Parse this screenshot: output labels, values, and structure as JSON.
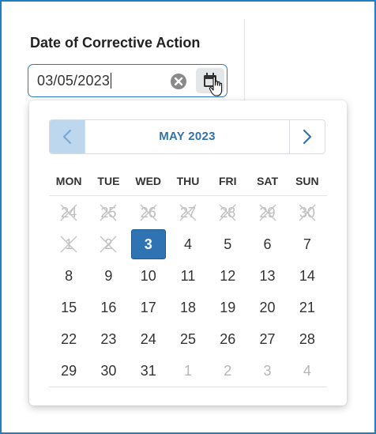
{
  "field": {
    "label": "Date of Corrective Action",
    "value": "03/05/2023"
  },
  "icons": {
    "clear": "clear-x-circle-icon",
    "calendar": "calendar-icon"
  },
  "calendar": {
    "month_title": "MAY 2023",
    "weekdays": [
      "MON",
      "TUE",
      "WED",
      "THU",
      "FRI",
      "SAT",
      "SUN"
    ],
    "weeks": [
      [
        {
          "d": "24",
          "state": "disabled"
        },
        {
          "d": "25",
          "state": "disabled"
        },
        {
          "d": "26",
          "state": "disabled"
        },
        {
          "d": "27",
          "state": "disabled"
        },
        {
          "d": "28",
          "state": "disabled"
        },
        {
          "d": "29",
          "state": "disabled"
        },
        {
          "d": "30",
          "state": "disabled"
        }
      ],
      [
        {
          "d": "1",
          "state": "disabled"
        },
        {
          "d": "2",
          "state": "disabled"
        },
        {
          "d": "3",
          "state": "selected"
        },
        {
          "d": "4",
          "state": "normal"
        },
        {
          "d": "5",
          "state": "normal"
        },
        {
          "d": "6",
          "state": "normal"
        },
        {
          "d": "7",
          "state": "normal"
        }
      ],
      [
        {
          "d": "8",
          "state": "normal"
        },
        {
          "d": "9",
          "state": "normal"
        },
        {
          "d": "10",
          "state": "normal"
        },
        {
          "d": "11",
          "state": "normal"
        },
        {
          "d": "12",
          "state": "normal"
        },
        {
          "d": "13",
          "state": "normal"
        },
        {
          "d": "14",
          "state": "normal"
        }
      ],
      [
        {
          "d": "15",
          "state": "normal"
        },
        {
          "d": "16",
          "state": "normal"
        },
        {
          "d": "17",
          "state": "normal"
        },
        {
          "d": "18",
          "state": "normal"
        },
        {
          "d": "19",
          "state": "normal"
        },
        {
          "d": "20",
          "state": "normal"
        },
        {
          "d": "21",
          "state": "normal"
        }
      ],
      [
        {
          "d": "22",
          "state": "normal"
        },
        {
          "d": "23",
          "state": "normal"
        },
        {
          "d": "24",
          "state": "normal"
        },
        {
          "d": "25",
          "state": "normal"
        },
        {
          "d": "26",
          "state": "normal"
        },
        {
          "d": "27",
          "state": "normal"
        },
        {
          "d": "28",
          "state": "normal"
        }
      ],
      [
        {
          "d": "29",
          "state": "normal"
        },
        {
          "d": "30",
          "state": "normal"
        },
        {
          "d": "31",
          "state": "normal"
        },
        {
          "d": "1",
          "state": "outside"
        },
        {
          "d": "2",
          "state": "outside"
        },
        {
          "d": "3",
          "state": "outside"
        },
        {
          "d": "4",
          "state": "outside"
        }
      ]
    ]
  },
  "colors": {
    "accent": "#2f73b3",
    "frame": "#1f7ec4",
    "prev_button_bg": "#bcd7ee"
  }
}
